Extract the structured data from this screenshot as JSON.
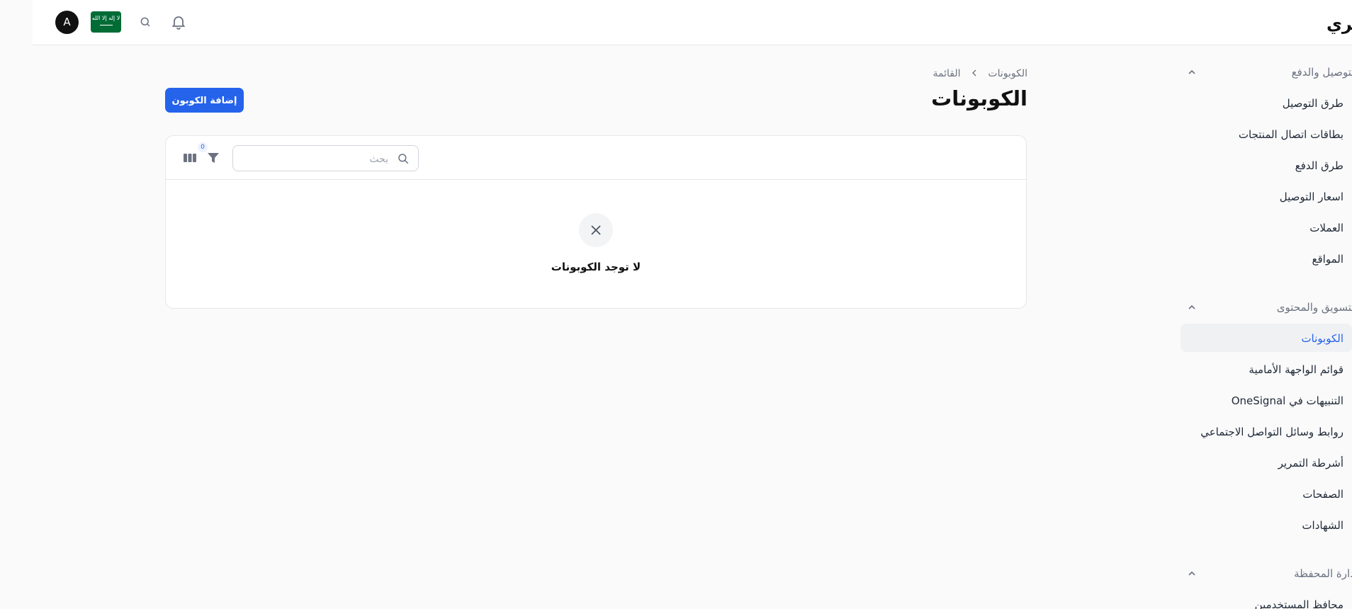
{
  "header": {
    "brand": "متجري",
    "avatar_initial": "A",
    "flag_text": "لا إله إلا الله",
    "icons": [
      "bell-icon",
      "search-icon",
      "saudi-flag-icon"
    ]
  },
  "sidebar": {
    "groups": [
      {
        "label": "التوصيل والدفع",
        "items": [
          {
            "label": "طرق التوصيل"
          },
          {
            "label": "بطاقات اتصال المنتجات"
          },
          {
            "label": "طرق الدفع"
          },
          {
            "label": "اسعار التوصيل"
          },
          {
            "label": "العملات"
          },
          {
            "label": "المواقع"
          }
        ]
      },
      {
        "label": "التسويق والمحتوى",
        "items": [
          {
            "label": "الكوبونات",
            "active": true
          },
          {
            "label": "قوائم الواجهة الأمامية"
          },
          {
            "label": "التنبيهات في OneSignal"
          },
          {
            "label": "روابط وسائل التواصل الاجتماعي"
          },
          {
            "label": "أشرطة التمرير"
          },
          {
            "label": "الصفحات"
          },
          {
            "label": "الشهادات"
          }
        ]
      },
      {
        "label": "إدارة المحفظة",
        "items": [
          {
            "label": "محافظ المستخدمين"
          }
        ]
      }
    ]
  },
  "main": {
    "breadcrumb": [
      "الكوبونات",
      "القائمة"
    ],
    "title": "الكوبونات",
    "add_button": "إضافة الكوبون",
    "search_placeholder": "بحث",
    "filter_count": "0",
    "empty_text": "لا توجد الكوبونات"
  },
  "colors": {
    "accent": "#2563eb",
    "active_text": "#2563eb",
    "flag_green": "#006c35"
  }
}
